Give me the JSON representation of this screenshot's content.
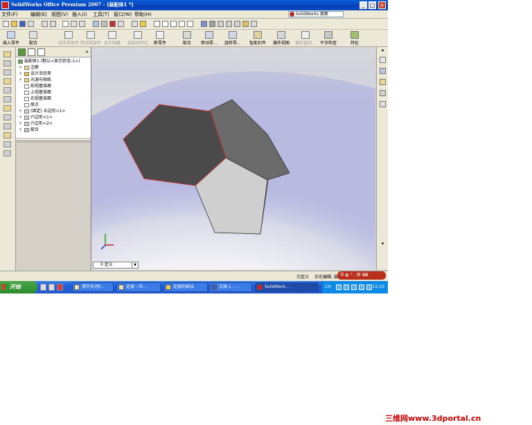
{
  "window": {
    "title": "SolidWorks Office Premium 2007 - [装配体1 *]",
    "buttons": {
      "minimize": "_",
      "maximize": "□",
      "close": "×"
    }
  },
  "menu": {
    "items": [
      "文件(F)",
      "编辑(E)",
      "视图(V)",
      "插入(I)",
      "工具(T)",
      "窗口(W)",
      "帮助(H)"
    ],
    "search_placeholder": "SolidWorks 搜索"
  },
  "command_toolbar": {
    "items": [
      {
        "label": "插入零件",
        "dim": false
      },
      {
        "label": "配合",
        "dim": false
      },
      {
        "label": "线性零部件",
        "dim": true
      },
      {
        "label": "移动零部件",
        "dim": true
      },
      {
        "label": "显示隐藏",
        "dim": true
      },
      {
        "label": "装配体特征",
        "dim": true
      },
      {
        "label": "新零件",
        "dim": false
      },
      {
        "label": "配合",
        "dim": false
      },
      {
        "label": "移动零...",
        "dim": false
      },
      {
        "label": "旋转零...",
        "dim": false
      },
      {
        "label": "智能扣件",
        "dim": false
      },
      {
        "label": "爆炸视图",
        "dim": false
      },
      {
        "label": "爆炸直线...",
        "dim": true
      },
      {
        "label": "干涉检查",
        "dim": false
      },
      {
        "label": "特征",
        "dim": false
      }
    ]
  },
  "feature_tree": {
    "root": "装配体1 (默认<显示状态-1>)",
    "items": [
      {
        "label": "注解",
        "expander": "+"
      },
      {
        "label": "设计活页夹",
        "expander": "+"
      },
      {
        "label": "光源与相机",
        "expander": "+"
      },
      {
        "label": "前视基准面",
        "expander": ""
      },
      {
        "label": "上视基准面",
        "expander": ""
      },
      {
        "label": "右视基准面",
        "expander": ""
      },
      {
        "label": "原点",
        "expander": ""
      },
      {
        "label": "(固定) 五边形<1>",
        "expander": "+"
      },
      {
        "label": "六边形<1>",
        "expander": "+"
      },
      {
        "label": "六边形<2>",
        "expander": "+"
      },
      {
        "label": "配合",
        "expander": "+"
      }
    ]
  },
  "graphics": {
    "view_combo": "0 定义",
    "colors": {
      "background": "#c7c9e9",
      "floor_highlight": "#ffffff",
      "hexagon_front": "#4a4a4a",
      "hexagon_back": "#6b6b6b",
      "pentagon": "#cfcfcf",
      "selected_edge": "#c03030"
    }
  },
  "status": {
    "left_field": "欠定义",
    "right_field": "正在编辑: 装配体"
  },
  "ime_bar": "中 ◐ ° , 拼 ⌨",
  "taskbar": {
    "start_label": "开始",
    "tasks": [
      {
        "label": "清华天河P..."
      },
      {
        "label": "足球 - 中..."
      },
      {
        "label": "足球的画法"
      },
      {
        "label": "文档 1 - ..."
      },
      {
        "label": "SolidWork..."
      }
    ],
    "tray_lang": "CH",
    "clock": "15:25"
  },
  "watermark": "三维网www.3dportal.cn"
}
